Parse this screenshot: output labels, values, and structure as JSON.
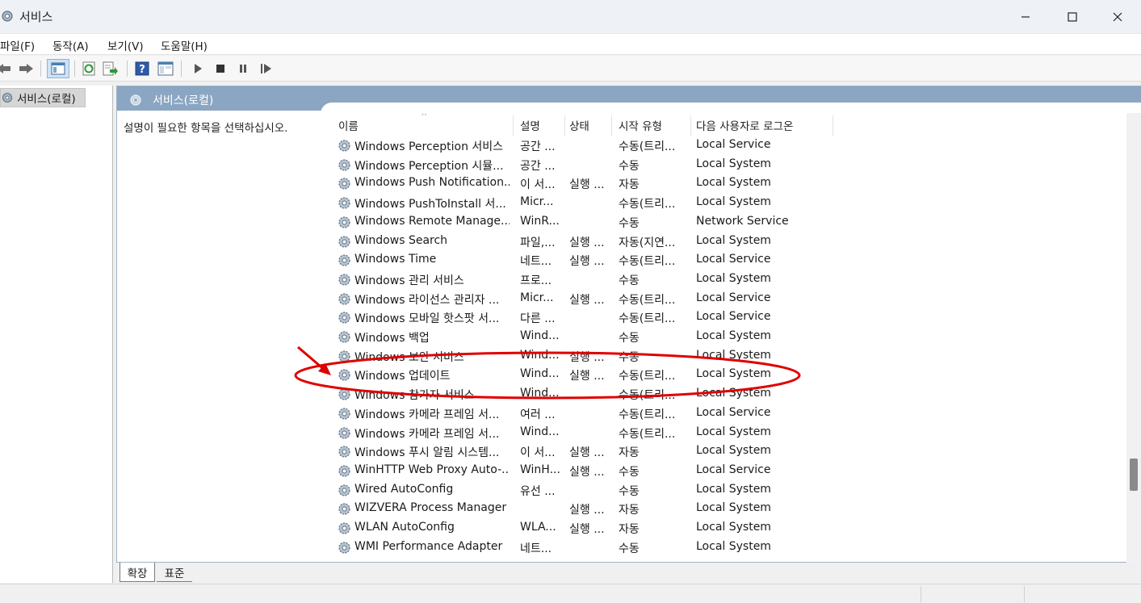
{
  "window": {
    "title": "서비스"
  },
  "menu": {
    "items": [
      "파일(F)",
      "동작(A)",
      "보기(V)",
      "도움말(H)"
    ]
  },
  "toolbar": {
    "buttons": [
      "back-icon",
      "forward-icon",
      "console-tree-icon",
      "refresh-icon",
      "export-list-icon",
      "help-icon",
      "properties-icon",
      "start-service-icon",
      "stop-service-icon",
      "pause-service-icon",
      "restart-service-icon"
    ]
  },
  "tree": {
    "root_label": "서비스(로컬)"
  },
  "pane": {
    "header": "서비스(로컬)",
    "description": "설명이 필요한 항목을 선택하십시오."
  },
  "columns": [
    "이름",
    "설명",
    "상태",
    "시작 유형",
    "다음 사용자로 로그온"
  ],
  "services": [
    {
      "name": "Windows Perception 서비스",
      "desc": "공간 ...",
      "status": "",
      "startup": "수동(트리...",
      "logon": "Local Service"
    },
    {
      "name": "Windows Perception 시뮬...",
      "desc": "공간 ...",
      "status": "",
      "startup": "수동",
      "logon": "Local System"
    },
    {
      "name": "Windows Push Notification...",
      "desc": "이 서...",
      "status": "실행 ...",
      "startup": "자동",
      "logon": "Local System"
    },
    {
      "name": "Windows PushToInstall 서...",
      "desc": "Micr...",
      "status": "",
      "startup": "수동(트리...",
      "logon": "Local System"
    },
    {
      "name": "Windows Remote Manage...",
      "desc": "WinR...",
      "status": "",
      "startup": "수동",
      "logon": "Network Service"
    },
    {
      "name": "Windows Search",
      "desc": "파일,...",
      "status": "실행 ...",
      "startup": "자동(지연...",
      "logon": "Local System"
    },
    {
      "name": "Windows Time",
      "desc": "네트...",
      "status": "실행 ...",
      "startup": "수동(트리...",
      "logon": "Local Service"
    },
    {
      "name": "Windows 관리 서비스",
      "desc": "프로...",
      "status": "",
      "startup": "수동",
      "logon": "Local System"
    },
    {
      "name": "Windows 라이선스 관리자 ...",
      "desc": "Micr...",
      "status": "실행 ...",
      "startup": "수동(트리...",
      "logon": "Local Service"
    },
    {
      "name": "Windows 모바일 핫스팟 서...",
      "desc": "다른 ...",
      "status": "",
      "startup": "수동(트리...",
      "logon": "Local Service"
    },
    {
      "name": "Windows 백업",
      "desc": "Wind...",
      "status": "",
      "startup": "수동",
      "logon": "Local System"
    },
    {
      "name": "Windows 보안 서비스",
      "desc": "Wind...",
      "status": "실행 ...",
      "startup": "수동",
      "logon": "Local System"
    },
    {
      "name": "Windows 업데이트",
      "desc": "Wind...",
      "status": "실행 ...",
      "startup": "수동(트리...",
      "logon": "Local System"
    },
    {
      "name": "Windows 참가자 서비스",
      "desc": "Wind...",
      "status": "",
      "startup": "수동(트리...",
      "logon": "Local System"
    },
    {
      "name": "Windows 카메라 프레임 서...",
      "desc": "여러 ...",
      "status": "",
      "startup": "수동(트리...",
      "logon": "Local Service"
    },
    {
      "name": "Windows 카메라 프레임 서...",
      "desc": "Wind...",
      "status": "",
      "startup": "수동(트리...",
      "logon": "Local System"
    },
    {
      "name": "Windows 푸시 알림 시스템...",
      "desc": "이 서...",
      "status": "실행 ...",
      "startup": "자동",
      "logon": "Local System"
    },
    {
      "name": "WinHTTP Web Proxy Auto-...",
      "desc": "WinH...",
      "status": "실행 ...",
      "startup": "수동",
      "logon": "Local Service"
    },
    {
      "name": "Wired AutoConfig",
      "desc": "유선 ...",
      "status": "",
      "startup": "수동",
      "logon": "Local System"
    },
    {
      "name": "WIZVERA Process Manager ...",
      "desc": "",
      "status": "실행 ...",
      "startup": "자동",
      "logon": "Local System"
    },
    {
      "name": "WLAN AutoConfig",
      "desc": "WLA...",
      "status": "실행 ...",
      "startup": "자동",
      "logon": "Local System"
    },
    {
      "name": "WMI Performance Adapter",
      "desc": "네트...",
      "status": "",
      "startup": "수동",
      "logon": "Local System"
    }
  ],
  "tabs": {
    "extended": "확장",
    "standard": "표준"
  },
  "annotation": {
    "highlight_color": "#e00000",
    "highlighted_service": "Windows 업데이트"
  }
}
